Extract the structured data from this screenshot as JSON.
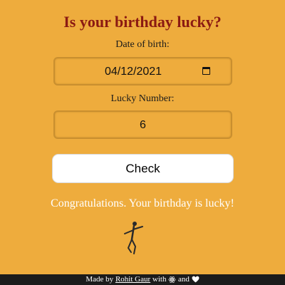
{
  "title": "Is your birthday lucky?",
  "dob": {
    "label": "Date of birth:",
    "value": "04/12/2021",
    "icon": "calendar-icon"
  },
  "lucky": {
    "label": "Lucky Number:",
    "value": "6"
  },
  "check_label": "Check",
  "result": "Congratulations. Your birthday is lucky!",
  "footer": {
    "made_by": "Made by",
    "author": "Rohit Gaur",
    "with": "with",
    "and": "and",
    "icons": [
      "react-icon",
      "heart-icon"
    ]
  },
  "colors": {
    "background": "#eeac3d",
    "title": "#8b1a12",
    "footer_bg": "#1b1b1b"
  }
}
